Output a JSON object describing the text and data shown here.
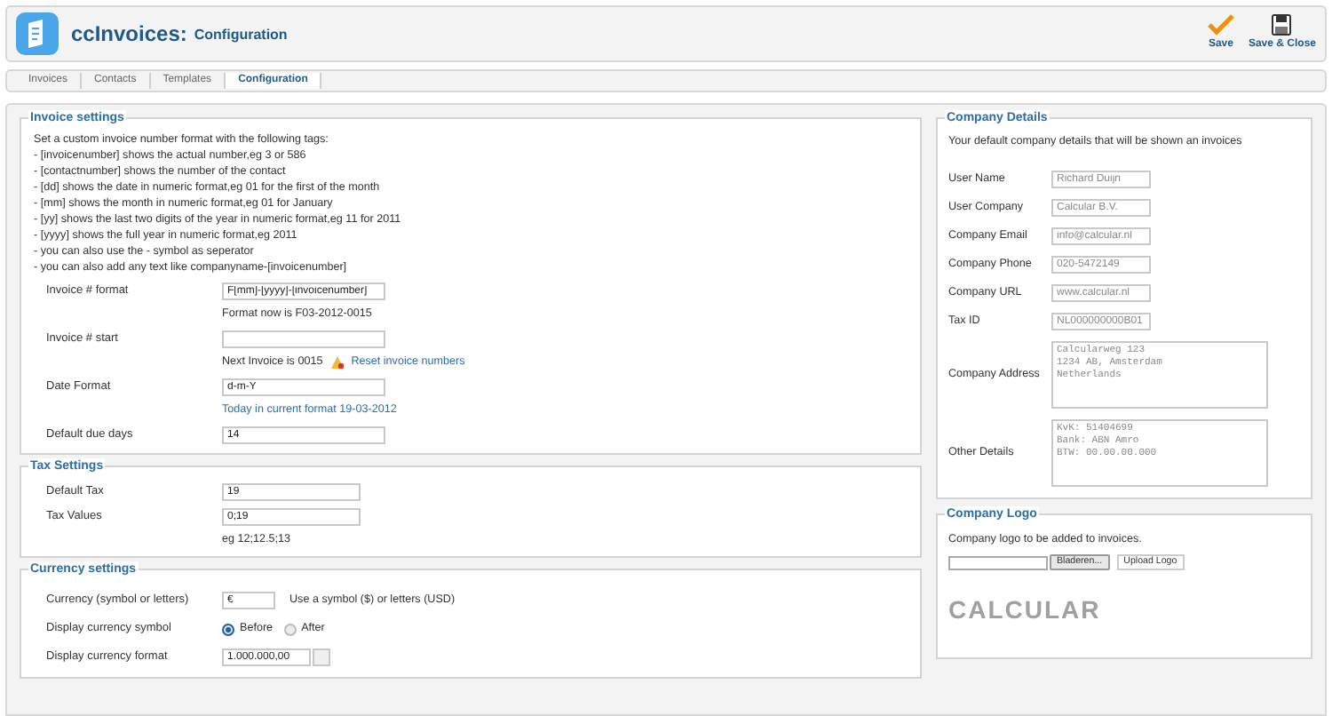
{
  "header": {
    "app": "ccInvoices:",
    "page": "Configuration",
    "buttons": [
      {
        "kind": "save",
        "label": "Save"
      },
      {
        "kind": "save-close",
        "label": "Save & Close"
      }
    ]
  },
  "tabs": [
    {
      "label": "Invoices",
      "selected": false
    },
    {
      "label": "Contacts",
      "selected": false
    },
    {
      "label": "Templates",
      "selected": false
    },
    {
      "label": "Configuration",
      "selected": true
    }
  ],
  "invoice_settings": {
    "title": "Invoice settings",
    "help": [
      "Set a custom invoice number format with the following tags:",
      "- [invoicenumber] shows the actual number,eg 3 or 586",
      "- [contactnumber] shows the number of the contact",
      "- [dd] shows the date in numeric format,eg 01 for the first of the month",
      "- [mm] shows the month in numeric format,eg 01 for January",
      "- [yy] shows the last two digits of the year in numeric format,eg 11 for 2011",
      "- [yyyy] shows the full year in numeric format,eg 2011",
      "- you can also use the - symbol as seperator",
      "- you can also add any text like companyname-[invoicenumber]"
    ],
    "fields": [
      {
        "label": "Invoice # format",
        "value": "F[mm]-[yyyy]-[invoicenumber]",
        "note": "Format now is F03-2012-0015"
      },
      {
        "label": "Invoice # start",
        "note": "Next Invoice is 0015",
        "link": "Reset invoice numbers"
      },
      {
        "label": "Date Format",
        "value": "d-m-Y",
        "link_note": "Today in current format 19-03-2012"
      },
      {
        "label": "Default due days",
        "value": "14"
      }
    ]
  },
  "tax_settings": {
    "title": "Tax Settings",
    "fields": [
      {
        "label": "Default Tax",
        "value": "19"
      },
      {
        "label": "Tax Values",
        "value": "0;19",
        "note": "eg 12;12.5;13"
      }
    ]
  },
  "currency_settings": {
    "title": "Currency settings",
    "currency": {
      "label": "Currency (symbol or letters)",
      "value": "€",
      "note": "Use a symbol ($) or letters (USD)"
    },
    "symbol_position": {
      "label": "Display currency symbol",
      "options": [
        {
          "label": "Before",
          "selected": true
        },
        {
          "label": "After",
          "selected": false
        }
      ]
    },
    "format": {
      "label": "Display currency format",
      "value": "1.000.000,00"
    }
  },
  "company_details": {
    "title": "Company Details",
    "intro": "Your default company details that will be shown an invoices",
    "fields": [
      {
        "kind": "input",
        "label": "User Name",
        "placeholder": "Richard Duijn"
      },
      {
        "kind": "input",
        "label": "User Company",
        "placeholder": "Calcular B.V."
      },
      {
        "kind": "input",
        "label": "Company Email",
        "placeholder": "info@calcular.nl"
      },
      {
        "kind": "input",
        "label": "Company Phone",
        "placeholder": "020-5472149"
      },
      {
        "kind": "input",
        "label": "Company URL",
        "placeholder": "www.calcular.nl"
      },
      {
        "kind": "input",
        "label": "Tax ID",
        "placeholder": "NL000000000B01"
      },
      {
        "kind": "textarea",
        "label": "Company Address",
        "placeholder": "Calcularweg 123\n1234 AB, Amsterdam\nNetherlands"
      },
      {
        "kind": "textarea",
        "label": "Other Details",
        "placeholder": "KvK: 51404699\nBank: ABN Amro\nBTW: 00.00.00.000"
      }
    ]
  },
  "company_logo": {
    "title": "Company Logo",
    "intro": "Company logo to be added to invoices.",
    "browse": "Bladeren...",
    "upload": "Upload Logo",
    "preview": "CALCULAR"
  }
}
